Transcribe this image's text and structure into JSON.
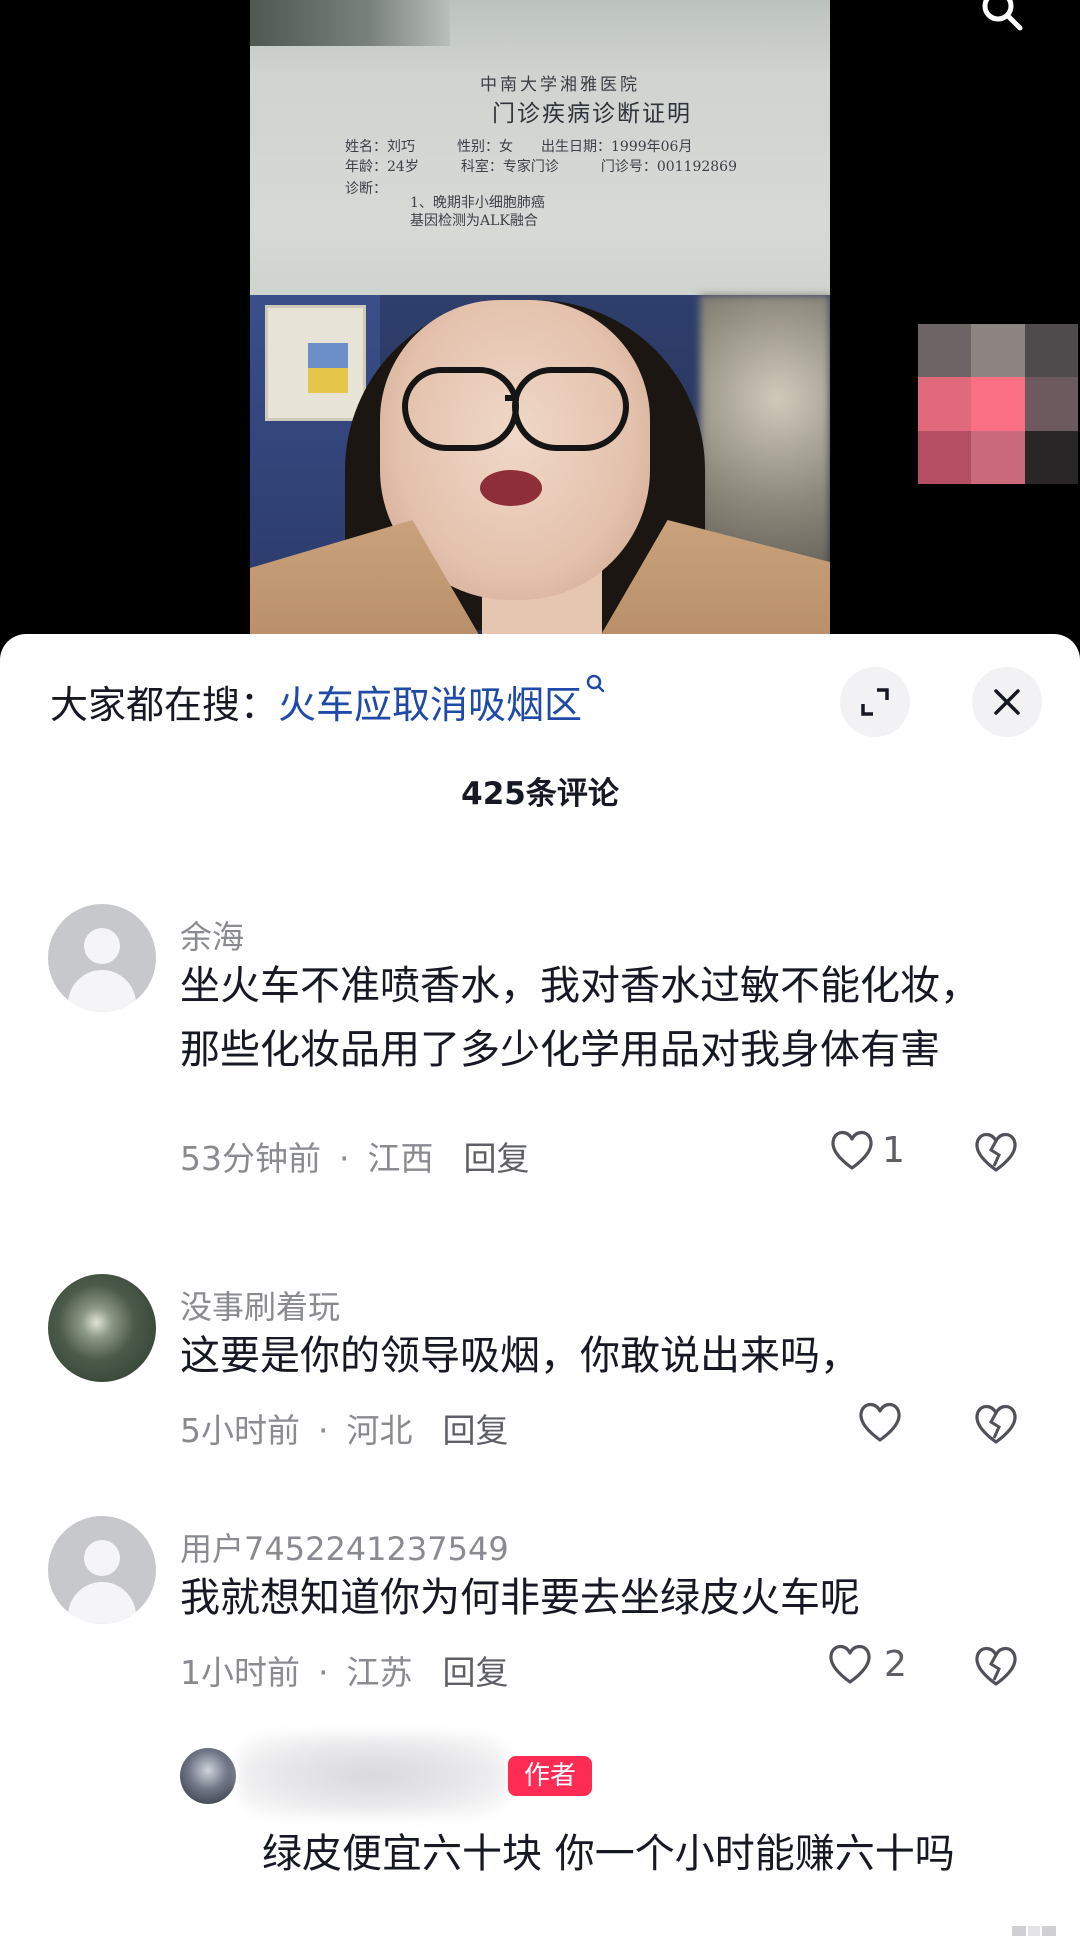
{
  "video": {
    "doc_hospital": "中南大学湘雅医院",
    "doc_title": "门诊疾病诊断证明",
    "doc_row1": "姓名：刘巧　　　性别：女　　出生日期：1999年06月",
    "doc_row2": "年龄：24岁　　　科室：专家门诊　　　门诊号：001192869",
    "doc_row3": "诊断：",
    "doc_row4": "1、晚期非小细胞肺癌",
    "doc_row5": "基因检测为ALK融合"
  },
  "sheet": {
    "hot_search_prefix": "大家都在搜：",
    "hot_search_term": "火车应取消吸烟区",
    "comment_count": "425条评论"
  },
  "comments": [
    {
      "username": "余海",
      "text": "坐火车不准喷香水，我对香水过敏不能化妆，那些化妆品用了多少化学用品对我身体有害",
      "time": "53分钟前",
      "location": "江西",
      "reply_label": "回复",
      "likes": "1"
    },
    {
      "username": "没事刷着玩",
      "text": "这要是你的领导吸烟，你敢说出来吗，",
      "time": "5小时前",
      "location": "河北",
      "reply_label": "回复",
      "likes": ""
    },
    {
      "username": "用户7452241237549",
      "text": "我就想知道你为何非要去坐绿皮火车呢",
      "time": "1小时前",
      "location": "江苏",
      "reply_label": "回复",
      "likes": "2"
    }
  ],
  "author_reply": {
    "badge": "作者",
    "text": "绿皮便宜六十块 你一个小时能赚六十吗"
  },
  "colors": {
    "accent": "#fe2c55",
    "link": "#1f4aa8",
    "meta": "#8a8b91"
  }
}
